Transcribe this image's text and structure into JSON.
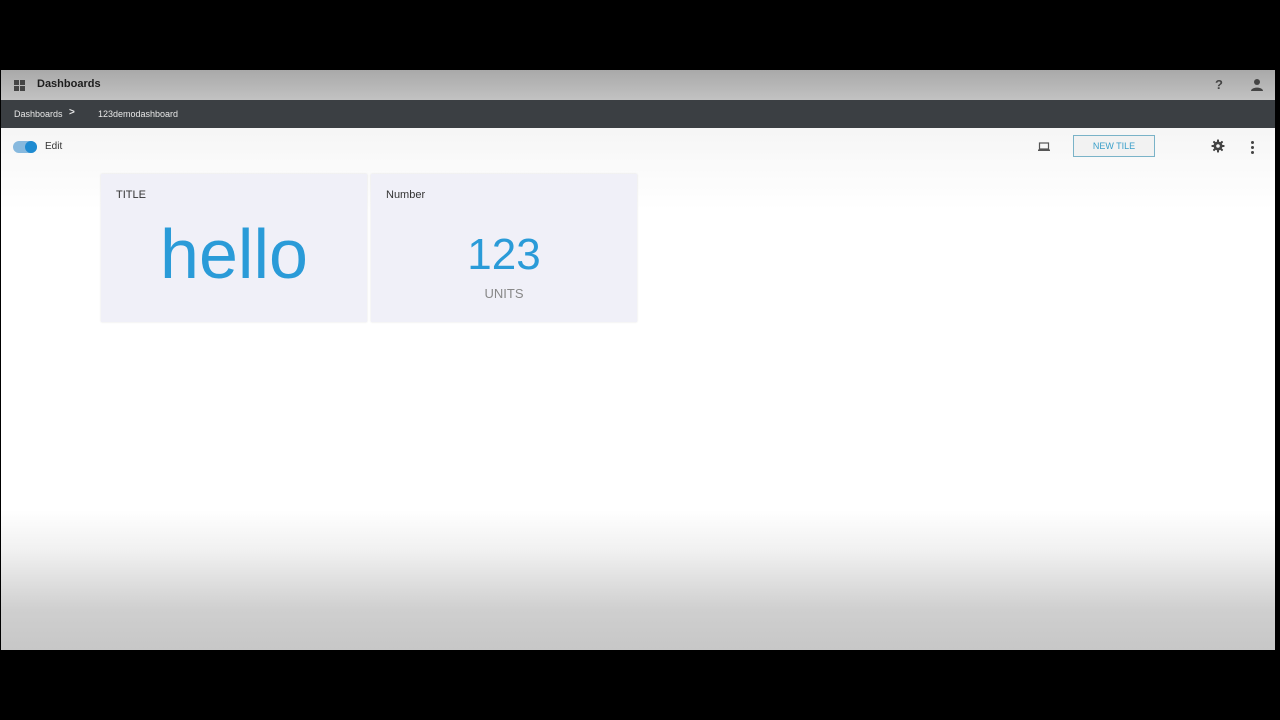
{
  "app": {
    "title": "Dashboards",
    "icons": {
      "apps": "apps-grid-icon",
      "help": "help-icon",
      "user": "user-icon"
    },
    "help_glyph": "?"
  },
  "breadcrumb": {
    "items": [
      "Dashboards",
      "123demodashboard"
    ],
    "separator": ">"
  },
  "toolbar": {
    "edit_label": "Edit",
    "edit_enabled": true,
    "new_tile_label": "NEW TILE",
    "icons": {
      "display": "display-icon",
      "settings": "gear-icon",
      "more": "more-vertical-icon"
    }
  },
  "tiles": [
    {
      "title": "TITLE",
      "value": "hello"
    },
    {
      "title": "Number",
      "value": "123",
      "units": "UNITS"
    }
  ],
  "colors": {
    "accent": "#2a9bd8",
    "breadcrumb_bar": "#3b3f43",
    "toggle_on": "#1e8bd1"
  }
}
